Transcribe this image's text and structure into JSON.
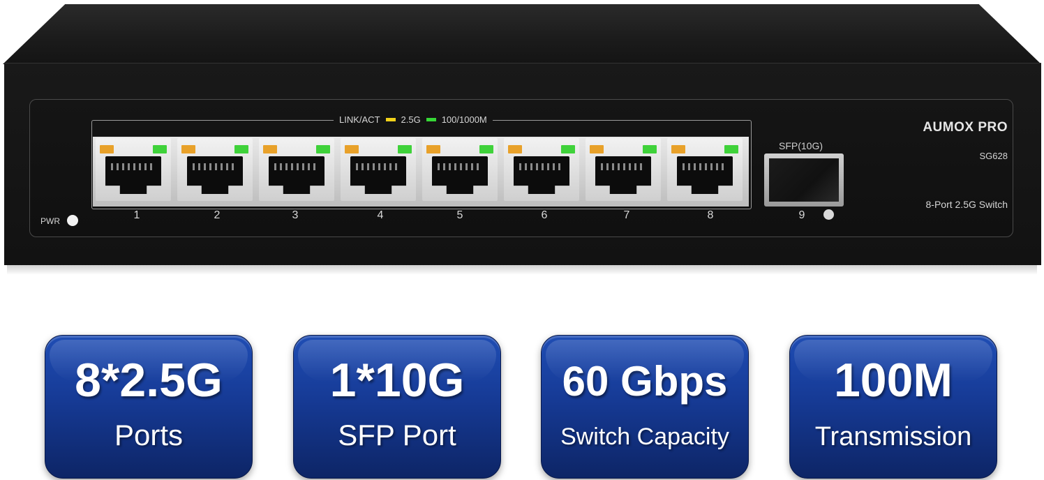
{
  "switch": {
    "legend": {
      "link_act": "LINK/ACT",
      "label_25g": "2.5G",
      "label_1000m": "100/1000M"
    },
    "brand": "AUMOX PRO",
    "model": "SG628",
    "description": "8-Port 2.5G Switch",
    "sfp_label": "SFP(10G)",
    "pwr_label": "PWR",
    "ports": [
      "1",
      "2",
      "3",
      "4",
      "5",
      "6",
      "7",
      "8"
    ],
    "sfp_port": "9"
  },
  "features": [
    {
      "big": "8*2.5G",
      "small": "Ports"
    },
    {
      "big": "1*10G",
      "small": "SFP Port"
    },
    {
      "big": "60 Gbps",
      "small": "Switch Capacity"
    },
    {
      "big": "100M",
      "small": "Transmission"
    }
  ]
}
